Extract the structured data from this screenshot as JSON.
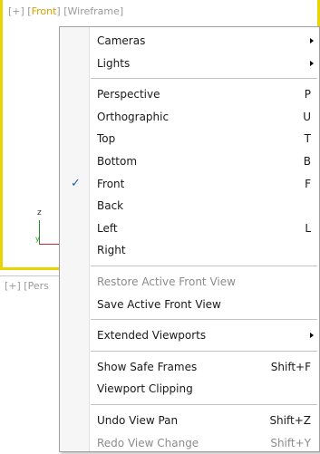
{
  "viewport_top": {
    "label_prefix": "[+] [",
    "view_name": "Front",
    "label_mid": "] [",
    "shading": "Wireframe",
    "label_suffix": "]"
  },
  "viewport_bottom": {
    "label": "[+] [Pers"
  },
  "axis": {
    "z_label": "z",
    "y_label": "y"
  },
  "colors": {
    "active_border": "#e8d400",
    "check_color": "#1f5fae"
  },
  "menu": {
    "groups": [
      [
        {
          "label": "Cameras",
          "shortcut": "",
          "submenu": true,
          "checked": false,
          "disabled": false
        },
        {
          "label": "Lights",
          "shortcut": "",
          "submenu": true,
          "checked": false,
          "disabled": false
        }
      ],
      [
        {
          "label": "Perspective",
          "shortcut": "P",
          "submenu": false,
          "checked": false,
          "disabled": false
        },
        {
          "label": "Orthographic",
          "shortcut": "U",
          "submenu": false,
          "checked": false,
          "disabled": false
        },
        {
          "label": "Top",
          "shortcut": "T",
          "submenu": false,
          "checked": false,
          "disabled": false
        },
        {
          "label": "Bottom",
          "shortcut": "B",
          "submenu": false,
          "checked": false,
          "disabled": false
        },
        {
          "label": "Front",
          "shortcut": "F",
          "submenu": false,
          "checked": true,
          "disabled": false
        },
        {
          "label": "Back",
          "shortcut": "",
          "submenu": false,
          "checked": false,
          "disabled": false
        },
        {
          "label": "Left",
          "shortcut": "L",
          "submenu": false,
          "checked": false,
          "disabled": false
        },
        {
          "label": "Right",
          "shortcut": "",
          "submenu": false,
          "checked": false,
          "disabled": false
        }
      ],
      [
        {
          "label": "Restore Active Front View",
          "shortcut": "",
          "submenu": false,
          "checked": false,
          "disabled": true
        },
        {
          "label": "Save Active Front View",
          "shortcut": "",
          "submenu": false,
          "checked": false,
          "disabled": false
        }
      ],
      [
        {
          "label": "Extended Viewports",
          "shortcut": "",
          "submenu": true,
          "checked": false,
          "disabled": false
        }
      ],
      [
        {
          "label": "Show Safe Frames",
          "shortcut": "Shift+F",
          "submenu": false,
          "checked": false,
          "disabled": false
        },
        {
          "label": "Viewport Clipping",
          "shortcut": "",
          "submenu": false,
          "checked": false,
          "disabled": false
        }
      ],
      [
        {
          "label": "Undo View Pan",
          "shortcut": "Shift+Z",
          "submenu": false,
          "checked": false,
          "disabled": false
        },
        {
          "label": "Redo View Change",
          "shortcut": "Shift+Y",
          "submenu": false,
          "checked": false,
          "disabled": true
        }
      ]
    ],
    "check_glyph": "✓"
  }
}
